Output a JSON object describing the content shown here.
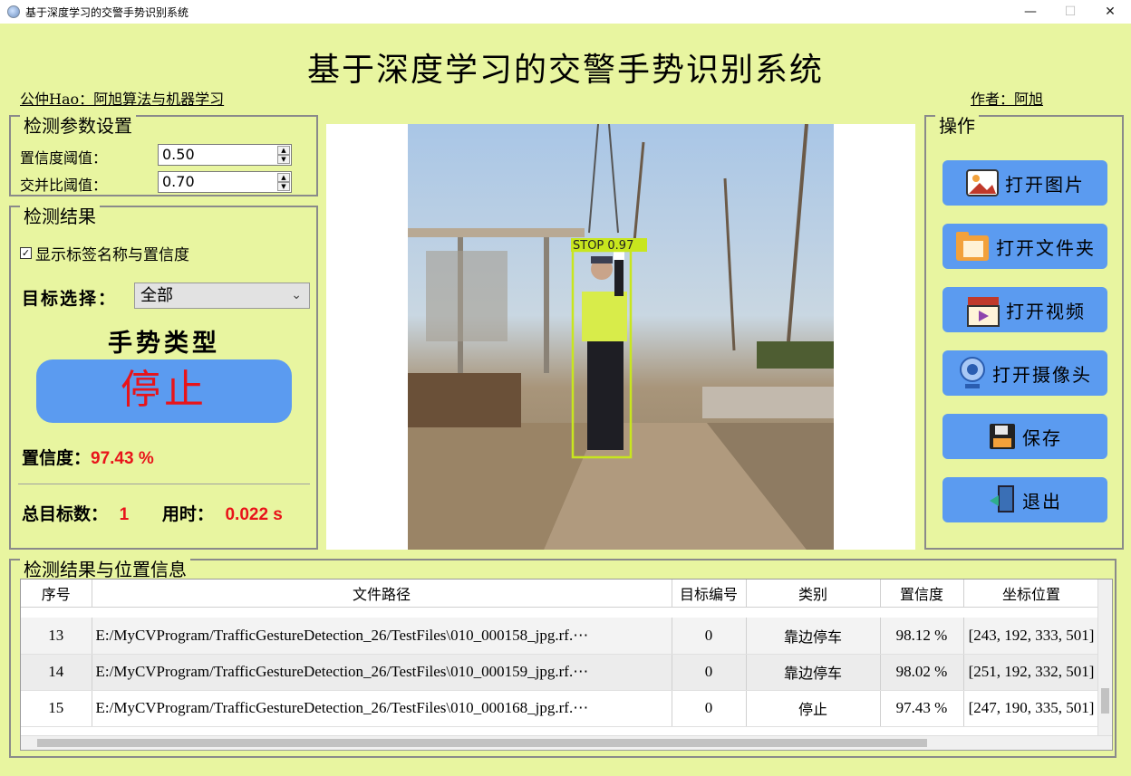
{
  "window": {
    "title": "基于深度学习的交警手势识别系统",
    "minimize": "—",
    "maximize": "☐",
    "close": "✕"
  },
  "header": {
    "title": "基于深度学习的交警手势识别系统",
    "left_note": "公仲Hao：阿旭算法与机器学习",
    "right_note": "作者：阿旭"
  },
  "params": {
    "title": "检测参数设置",
    "confidence_label": "置信度阈值：",
    "confidence_value": "0.50",
    "iou_label": "交并比阈值：",
    "iou_value": "0.70"
  },
  "result": {
    "title": "检测结果",
    "show_labels": "显示标签名称与置信度",
    "target_label": "目标选择：",
    "target_value": "全部",
    "gesture_type_label": "手势类型",
    "gesture_value": "停止",
    "confidence_label": "置信度：",
    "confidence_value": "97.43 %",
    "total_label": "总目标数：",
    "total_value": "1",
    "time_label": "用时：",
    "time_value": "0.022 s"
  },
  "image": {
    "box_label": "STOP  0.97"
  },
  "ops": {
    "title": "操作",
    "buttons": [
      "打开图片",
      "打开文件夹",
      "打开视频",
      "打开摄像头",
      "保存",
      "退出"
    ]
  },
  "table": {
    "title": "检测结果与位置信息",
    "columns": [
      "序号",
      "文件路径",
      "目标编号",
      "类别",
      "置信度",
      "坐标位置"
    ],
    "rows": [
      [
        "13",
        "E:/MyCVProgram/TrafficGestureDetection_26/TestFiles\\010_000158_jpg.rf.⋯",
        "0",
        "靠边停车",
        "98.12 %",
        "[243, 192, 333, 501]"
      ],
      [
        "14",
        "E:/MyCVProgram/TrafficGestureDetection_26/TestFiles\\010_000159_jpg.rf.⋯",
        "0",
        "靠边停车",
        "98.02 %",
        "[251, 192, 332, 501]"
      ],
      [
        "15",
        "E:/MyCVProgram/TrafficGestureDetection_26/TestFiles\\010_000168_jpg.rf.⋯",
        "0",
        "停止",
        "97.43 %",
        "[247, 190, 335, 501]"
      ]
    ]
  },
  "colors": {
    "background": "#e8f5a0",
    "button": "#5b9bf0",
    "accent_red": "#e8141a",
    "box": "#c8e61e"
  }
}
